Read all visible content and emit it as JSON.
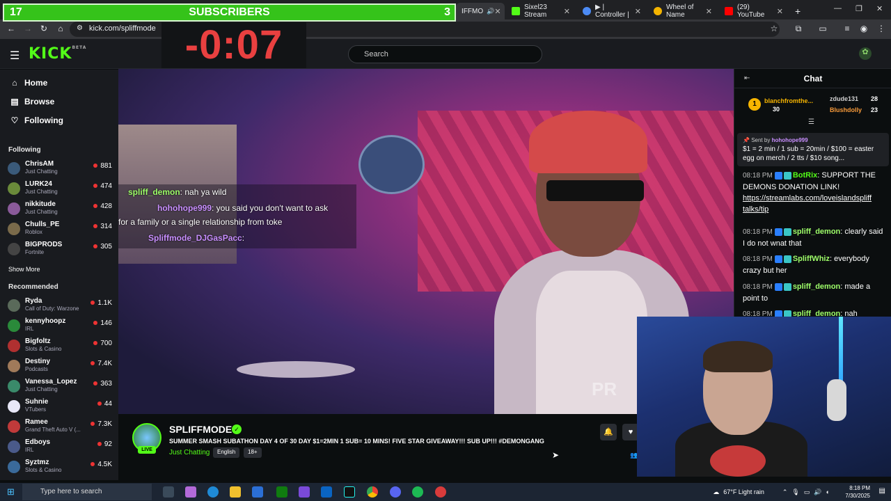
{
  "browser": {
    "tabs": [
      {
        "title": "IFFMO",
        "color": "#53fc18"
      },
      {
        "title": "Sixel23 Stream",
        "color": "#53fc18"
      },
      {
        "title": "▶ | Controller |",
        "color": "#4c8bf5"
      },
      {
        "title": "Wheel of Name",
        "color": "#f4b400"
      },
      {
        "title": "(29) YouTube",
        "color": "#ff0000"
      }
    ],
    "url": "kick.com/spliffmode"
  },
  "overlay": {
    "sub_left": "17",
    "sub_label": "SUBSCRIBERS",
    "sub_right": "3",
    "timer": "-0:07"
  },
  "header": {
    "logo": "KICK",
    "logo_sup": "BETA",
    "search_placeholder": "Search"
  },
  "sidebar": {
    "nav": [
      {
        "label": "Home",
        "icon": "⌂"
      },
      {
        "label": "Browse",
        "icon": "▤"
      },
      {
        "label": "Following",
        "icon": "♡"
      }
    ],
    "following_title": "Following",
    "following": [
      {
        "name": "ChrisAM",
        "game": "Just Chatting",
        "viewers": "881",
        "color": "#3a5a7a"
      },
      {
        "name": "LURK24",
        "game": "Just Chatting",
        "viewers": "474",
        "color": "#6a8a3a"
      },
      {
        "name": "nikkitude",
        "game": "Just Chatting",
        "viewers": "428",
        "color": "#8a5a9a"
      },
      {
        "name": "Chulls_PE",
        "game": "Roblox",
        "viewers": "314",
        "color": "#7a6a4a"
      },
      {
        "name": "BIGPRODS",
        "game": "Fortnite",
        "viewers": "305",
        "color": "#444"
      }
    ],
    "show_more": "Show More",
    "recommended_title": "Recommended",
    "recommended": [
      {
        "name": "Ryda",
        "game": "Call of Duty: Warzone",
        "viewers": "1.1K",
        "color": "#5a6a5a"
      },
      {
        "name": "kennyhoopz",
        "game": "IRL",
        "viewers": "146",
        "color": "#2a8a3a"
      },
      {
        "name": "Bigfoltz",
        "game": "Slots & Casino",
        "viewers": "700",
        "color": "#b03030"
      },
      {
        "name": "Destiny",
        "game": "Podcasts",
        "viewers": "7.4K",
        "color": "#a07a5a"
      },
      {
        "name": "Vanessa_Lopez",
        "game": "Just Chatting",
        "viewers": "363",
        "color": "#3a8a6a"
      },
      {
        "name": "Suhnie",
        "game": "VTubers",
        "viewers": "44",
        "color": "#e8e8f8"
      },
      {
        "name": "Ramee",
        "game": "Grand Theft Auto V (...",
        "viewers": "7.3K",
        "color": "#c03a3a"
      },
      {
        "name": "Edboys",
        "game": "IRL",
        "viewers": "92",
        "color": "#4a5a8a"
      },
      {
        "name": "Syztmz",
        "game": "Slots & Casino",
        "viewers": "4.5K",
        "color": "#3a6a9a"
      }
    ]
  },
  "video_chat_overlay": [
    {
      "user": "spliff_demon",
      "text": ": nah ya wild",
      "color": "#9fff6a"
    },
    {
      "user": "hohohope999",
      "text": ": you said you don't want to ask",
      "color": "#c98fff"
    },
    {
      "user": "",
      "text": "for a family or a single relationship from toke",
      "color": "#ffffff"
    },
    {
      "user": "Spliffmode_DJGasPacc",
      "text": ":",
      "color": "#c98fff"
    }
  ],
  "watermark": "PR",
  "stream": {
    "channel": "SPLIFFMODE",
    "live": "LIVE",
    "title": "SUMMER SMASH SUBATHON DAY 4 OF 30 DAY $1=2MIN 1 SUB= 10 MINS! FIVE STAR GIVEAWAY!!! SUB UP!!! #DEMONGANG",
    "category": "Just Chatting",
    "tags": [
      "English",
      "18+"
    ]
  },
  "chat": {
    "title": "Chat",
    "leaderboard": [
      {
        "name": "blanchfromthe...",
        "count": "30",
        "color": "#f7b500"
      },
      {
        "name": "zdude131",
        "count": "28",
        "color": "#cfcfcf"
      },
      {
        "name": "Blushdolly",
        "count": "23",
        "color": "#f79a3a"
      }
    ],
    "pinned_by_label": "Sent by",
    "pinned_by": "hohohope999",
    "pinned_text": "$1 = 2 min / 1 sub = 20min / $100 = easter egg on merch / 2 tts / $10 song...",
    "messages": [
      {
        "time": "08:18 PM",
        "user": "BotRix",
        "text": ": SUPPORT THE DEMONS DONATION LINK!",
        "link": "https://streamlabs.com/loveislandspliff talks/tip",
        "color": "#53fc18"
      },
      {
        "time": "08:18 PM",
        "user": "spliff_demon",
        "text": ": clearly said I do not wnat that",
        "link": "",
        "color": "#9fff6a"
      },
      {
        "time": "08:18 PM",
        "user": "SpliffWhiz",
        "text": ": everybody crazy but her",
        "link": "",
        "color": "#9fff6a"
      },
      {
        "time": "08:18 PM",
        "user": "spliff_demon",
        "text": ": made a point to",
        "link": "",
        "color": "#9fff6a"
      },
      {
        "time": "08:18 PM",
        "user": "spliff_demon",
        "text": ": nah",
        "link": "",
        "color": "#9fff6a"
      }
    ]
  },
  "taskbar": {
    "search_placeholder": "Type here to search",
    "weather": "67°F  Light rain",
    "time": "8:18 PM",
    "date": "7/30/2025"
  }
}
